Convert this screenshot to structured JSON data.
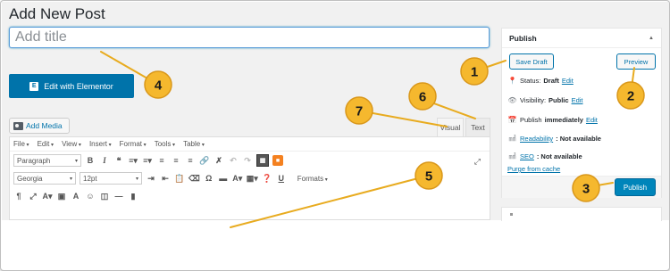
{
  "page": {
    "title": "Add New Post"
  },
  "title_input": {
    "placeholder": "Add title"
  },
  "elementor": {
    "label": "Edit with Elementor",
    "logo": "E"
  },
  "media": {
    "label": "Add Media"
  },
  "tabs": {
    "visual": "Visual",
    "text": "Text"
  },
  "menubar": [
    "File",
    "Edit",
    "View",
    "Insert",
    "Format",
    "Tools",
    "Table"
  ],
  "toolbar": {
    "paragraph": "Paragraph",
    "font_family": "Georgia",
    "font_size": "12pt",
    "formats": "Formats"
  },
  "publish": {
    "heading": "Publish",
    "save_draft": "Save Draft",
    "preview": "Preview",
    "status_label": "Status:",
    "status_value": "Draft",
    "visibility_label": "Visibility:",
    "visibility_value": "Public",
    "publish_label": "Publish",
    "publish_value": "immediately",
    "readability_label": "Readability",
    "readability_value": ": Not available",
    "seo_label": "SEO",
    "seo_value": ": Not available",
    "edit": "Edit",
    "purge": "Purge from cache",
    "publish_button": "Publish"
  },
  "annotations": [
    "1",
    "2",
    "3",
    "4",
    "5",
    "6",
    "7"
  ],
  "colors": {
    "accent": "#0073aa",
    "badge_fill": "#f5b82e",
    "badge_stroke": "#d9971a",
    "arrow": "#e8ab1f"
  }
}
